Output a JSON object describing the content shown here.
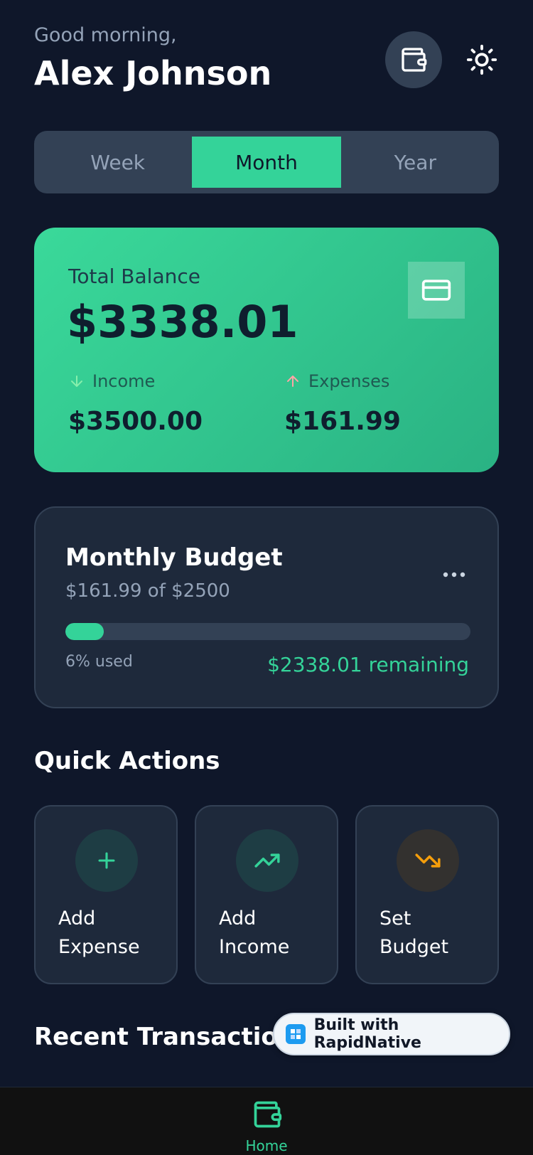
{
  "header": {
    "greeting": "Good morning,",
    "user_name": "Alex Johnson",
    "icons": {
      "wallet": "wallet-icon",
      "theme": "sun-icon"
    }
  },
  "period_tabs": {
    "items": [
      "Week",
      "Month",
      "Year"
    ],
    "selected": "Month"
  },
  "balance": {
    "label": "Total Balance",
    "value": "$3338.01",
    "card_icon": "credit-card-icon",
    "income": {
      "label": "Income",
      "value": "$3500.00",
      "icon": "arrow-down-icon"
    },
    "expenses": {
      "label": "Expenses",
      "value": "$161.99",
      "icon": "arrow-up-icon"
    }
  },
  "budget": {
    "title": "Monthly Budget",
    "subtitle": "$161.99 of $2500",
    "progress_fraction": 0.06,
    "used_text": "6% used",
    "remaining_text": "$2338.01 remaining",
    "more_icon": "more-dots-icon"
  },
  "quick_actions": {
    "title": "Quick Actions",
    "items": [
      {
        "label": "Add\nExpense",
        "icon": "plus-icon"
      },
      {
        "label": "Add\nIncome",
        "icon": "trending-up-icon"
      },
      {
        "label": "Set\nBudget",
        "icon": "trending-down-icon"
      }
    ]
  },
  "recent": {
    "title": "Recent Transactions"
  },
  "badge": {
    "text": "Built with RapidNative"
  },
  "nav": {
    "home_label": "Home",
    "home_icon": "wallet-icon"
  },
  "colors": {
    "background": "#0f172a",
    "card": "#1e293b",
    "accent": "#34d399",
    "expense_accent": "#f59e0b"
  }
}
